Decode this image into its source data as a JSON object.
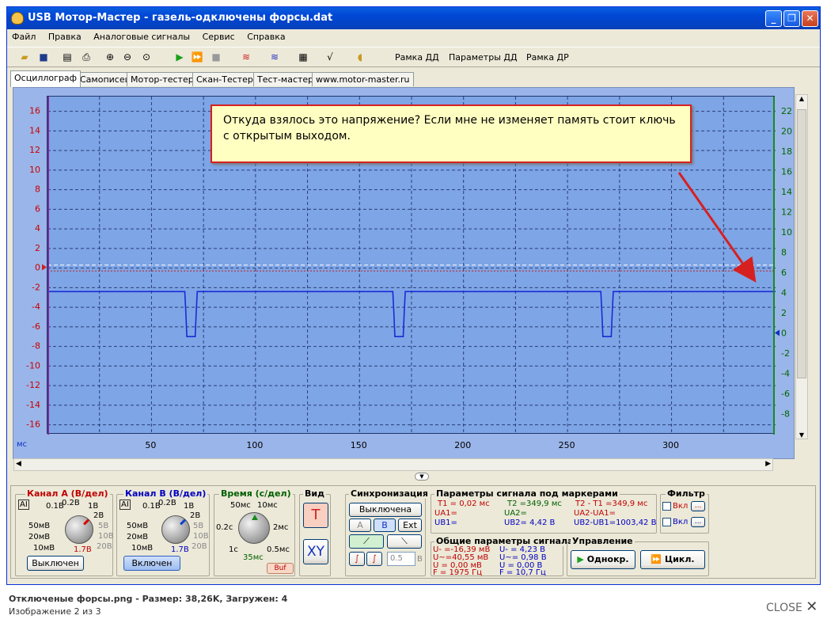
{
  "window": {
    "title": "USB Мотор-Мастер - газель-одключены форсы.dat",
    "min": "_",
    "max": "❐",
    "close": "✕"
  },
  "menu": [
    "Файл",
    "Правка",
    "Аналоговые сигналы",
    "Сервис",
    "Справка"
  ],
  "toolbar": {
    "rama_dd": "Рамка ДД",
    "params_dd": "Параметры ДД",
    "rama_dr": "Рамка ДР"
  },
  "tabs": [
    "Осциллограф",
    "Самописец",
    "Мотор-тестер",
    "Скан-Тестер",
    "Тест-мастер",
    "www.motor-master.ru"
  ],
  "callout": "Откуда взялось это напряжение? Если мне не изменяет память  стоит ключь с открытым выходом.",
  "chart_data": {
    "type": "line",
    "title": "",
    "xlabel": "мс",
    "xlim": [
      0,
      350
    ],
    "x_ticks": [
      50,
      100,
      150,
      200,
      250,
      300
    ],
    "left_axis": {
      "ylim": [
        -17,
        17.5
      ],
      "ticks": [
        16,
        14,
        12,
        10,
        8,
        6,
        4,
        2,
        0,
        -2,
        -4,
        -6,
        -8,
        -10,
        -12,
        -14,
        -16
      ],
      "color": "#cc0000"
    },
    "right_axis": {
      "ylim": [
        -10,
        23.5
      ],
      "ticks": [
        22,
        20,
        18,
        16,
        14,
        12,
        10,
        8,
        6,
        4,
        2,
        0,
        -2,
        -4,
        -6,
        -8
      ],
      "color": "#006600"
    },
    "series": [
      {
        "color": "#1a2bd6",
        "x": [
          0,
          66,
          66.5,
          67,
          71,
          71.5,
          72,
          166,
          166.5,
          167,
          171,
          171.5,
          172,
          266,
          266.5,
          267,
          271,
          271.5,
          272,
          350
        ],
        "y": [
          -2.4,
          -2.4,
          -4.5,
          -7,
          -7,
          -4.5,
          -2.4,
          -2.4,
          -4.5,
          -7,
          -7,
          -4.5,
          -2.4,
          -2.4,
          -4.5,
          -7,
          -7,
          -4.5,
          -2.4,
          -2.4
        ]
      }
    ]
  },
  "channel_a": {
    "title": "Канал А (В/дел)",
    "scales": [
      "0.1В",
      "0.2В",
      "1В",
      "2В",
      "5В",
      "10В",
      "20В",
      "10мВ",
      "20мВ",
      "50мВ"
    ],
    "value": "1.7В",
    "btn": "Выключен"
  },
  "channel_b": {
    "title": "Канал В (В/дел)",
    "scales": [
      "0.1В",
      "0.2В",
      "1В",
      "2В",
      "5В",
      "10В",
      "20В",
      "10мВ",
      "20мВ",
      "50мВ"
    ],
    "value": "1.7В",
    "btn": "Включен"
  },
  "time": {
    "title": "Время (с/дел)",
    "scales": [
      "50мс",
      "10мс",
      "0.2с",
      "2мс",
      "1с",
      "0.5мс"
    ],
    "value": "35мс",
    "buf": "Buf"
  },
  "view": {
    "title": "Вид",
    "t": "T",
    "xy": "XY"
  },
  "sync": {
    "title": "Синхронизация",
    "mode": "Выключена",
    "a": "A",
    "b": "B",
    "ext": "Ext",
    "level": "0.5",
    "unit": "В"
  },
  "markers": {
    "title": "Параметры сигнала под маркерами",
    "t1": "T1 = 0,02 мс",
    "t2": "T2 =349,9 мс",
    "dt": "T2 - T1 =349,9 мс",
    "ua1": "UA1=",
    "ua2": "UA2=",
    "dua": "UA2-UA1=",
    "ub1": "UB1=",
    "ub2": "UB2= 4,42 В",
    "dub": "UB2-UB1=1003,42 В"
  },
  "general": {
    "title": "Общие параметры сигнала",
    "a_dc": "U- =-16,39 мВ",
    "a_ac": "U~=40,55 мВ",
    "a_u": "U  = 0,00 мВ",
    "a_f": "F  = 1975 Гц",
    "b_dc": "U- = 4,23 В",
    "b_ac": "U~= 0,98 В",
    "b_u": "U  = 0,00 В",
    "b_f": "F  = 10,7 Гц"
  },
  "filter": {
    "title": "Фильтр",
    "on1": "Вкл",
    "on2": "Вкл",
    "dots": "..."
  },
  "control": {
    "title": "Управление",
    "single": "Однокр.",
    "cycle": "Цикл."
  },
  "footer": {
    "line1": "Отключеные форсы.png - Размер: 38,26K, Загружен: 4",
    "line2": "Изображение 2 из 3",
    "close": "CLOSE"
  }
}
